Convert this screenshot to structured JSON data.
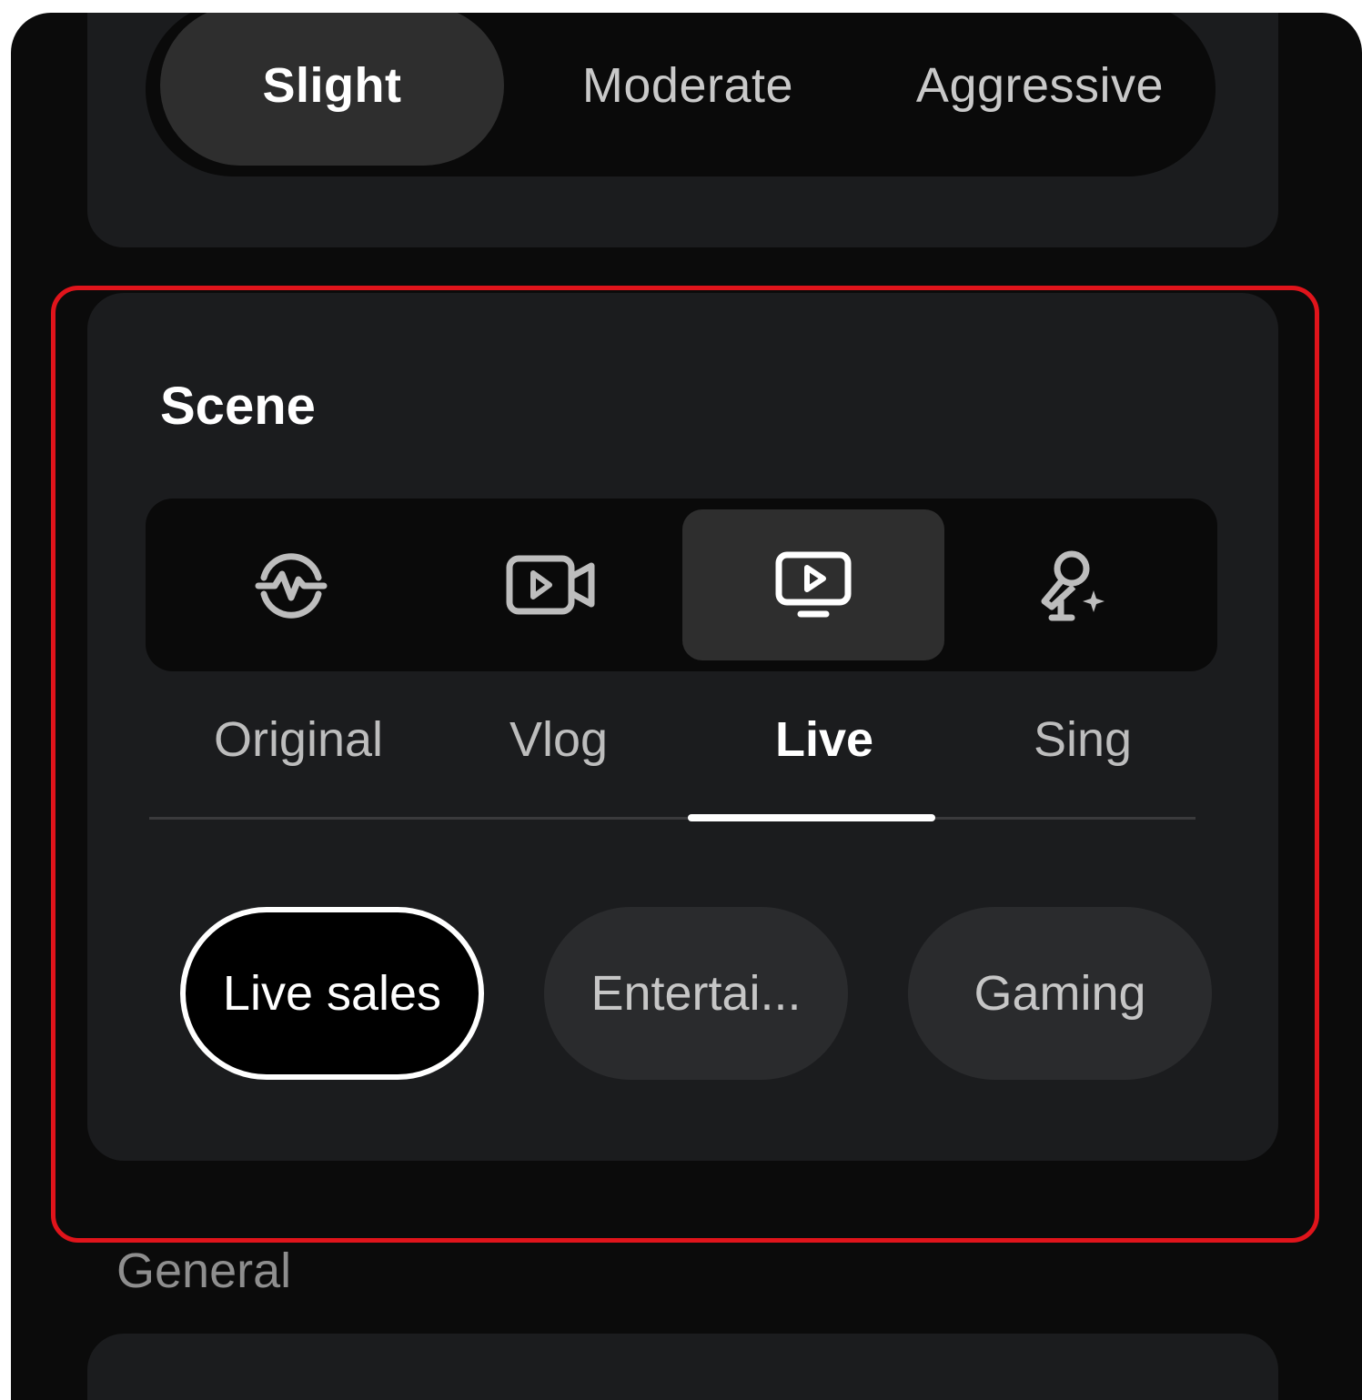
{
  "intensity": {
    "options": [
      "Slight",
      "Moderate",
      "Aggressive"
    ],
    "selected": "Slight"
  },
  "scene": {
    "title": "Scene",
    "tabs": [
      {
        "label": "Original",
        "icon": "waveform-icon"
      },
      {
        "label": "Vlog",
        "icon": "video-camera-icon"
      },
      {
        "label": "Live",
        "icon": "live-monitor-icon"
      },
      {
        "label": "Sing",
        "icon": "microphone-sparkle-icon"
      }
    ],
    "selected_tab": "Live",
    "subscenes": [
      "Live sales",
      "Entertai...",
      "Gaming"
    ],
    "selected_subscene": "Live sales"
  },
  "general": {
    "label": "General"
  },
  "colors": {
    "highlight": "#e0141b",
    "background": "#0b0b0b",
    "card": "#1b1c1e",
    "active_pill": "#2e2e2e"
  }
}
